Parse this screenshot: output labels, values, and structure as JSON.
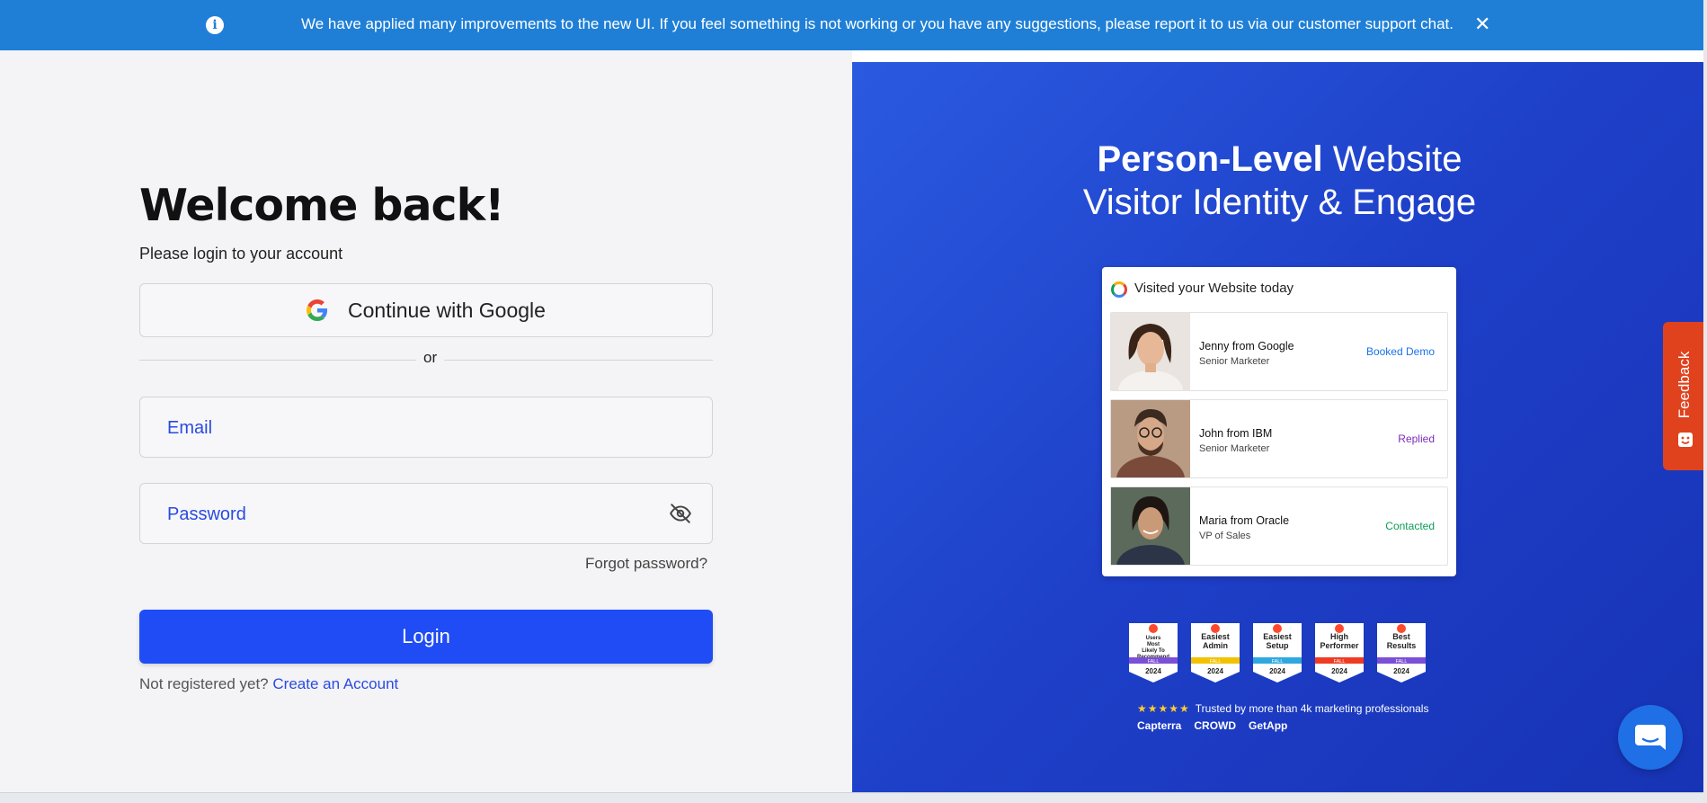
{
  "banner": {
    "message": "We have applied many improvements to the new UI. If you feel something is not working or you have any suggestions, please report it to us via our customer support chat.",
    "info_icon": "i",
    "close_icon": "✕"
  },
  "login": {
    "title": "Welcome back!",
    "subtitle": "Please login to your account",
    "google_label": "Continue with Google",
    "or_label": "or",
    "email_placeholder": "Email",
    "password_placeholder": "Password",
    "forgot_label": "Forgot password?",
    "login_label": "Login",
    "not_registered": "Not registered yet?",
    "create_account": "Create an Account"
  },
  "promo": {
    "headline_bold": "Person-Level",
    "headline_rest_1": " Website",
    "headline_line2": "Visitor Identity & Engage",
    "card_title": "Visited your Website today",
    "visitors": [
      {
        "name": "Jenny from Google",
        "role": "Senior Marketer",
        "status": "Booked Demo",
        "status_color": "#1a73e8"
      },
      {
        "name": "John from IBM",
        "role": "Senior Marketer",
        "status": "Replied",
        "status_color": "#7b2cbf"
      },
      {
        "name": "Maria from Oracle",
        "role": "VP of Sales",
        "status": "Contacted",
        "status_color": "#0b9e5a"
      }
    ],
    "badges": [
      {
        "title": "Users Most Likely To Recommend",
        "season": "FALL",
        "year": "2024",
        "ribbon": "#7b4fd6"
      },
      {
        "title": "Easiest Admin",
        "season": "FALL",
        "year": "2024",
        "ribbon": "#f2c200"
      },
      {
        "title": "Easiest Setup",
        "season": "FALL",
        "year": "2024",
        "ribbon": "#2fa8e0"
      },
      {
        "title": "High Performer",
        "season": "FALL",
        "year": "2024",
        "ribbon": "#ef3b24"
      },
      {
        "title": "Best Results",
        "season": "FALL",
        "year": "2024",
        "ribbon": "#7b4fd6"
      }
    ],
    "stars": "★★★★★",
    "trusted_text": "Trusted by more than 4k marketing professionals",
    "review_sites": [
      "Capterra",
      "CROWD",
      "GetApp"
    ]
  },
  "feedback_label": "Feedback"
}
